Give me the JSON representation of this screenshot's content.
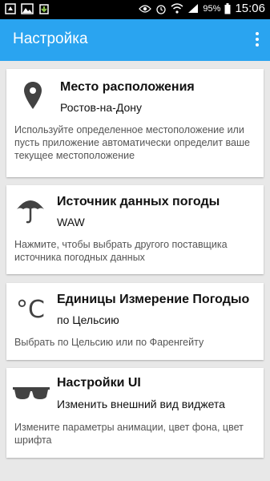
{
  "status_bar": {
    "battery_pct": "95%",
    "time": "15:06"
  },
  "app_bar": {
    "title": "Настройка",
    "overflow_icon": "more-vert-icon"
  },
  "cards": [
    {
      "icon": "location-pin-icon",
      "title": "Место расположения",
      "value": "Ростов-на-Дону",
      "description": "Используйте определенное местоположение или пусть приложение автоматически определит ваше текущее местоположение"
    },
    {
      "icon": "umbrella-icon",
      "title": "Источник данных погоды",
      "value": "WAW",
      "description": "Нажмите, чтобы выбрать другого поставщика источника погодных данных"
    },
    {
      "icon": "celsius-icon",
      "icon_glyph": "°C",
      "title": "Единицы Измерение Погодыо",
      "value": "по Цельсию",
      "description": "Выбрать по Цельсию или по Фаренгейту"
    },
    {
      "icon": "sunglasses-icon",
      "title": "Настройки UI",
      "value": "Изменить внешний вид виджета",
      "description": "Измените параметры анимации, цвет фона, цвет шрифта"
    }
  ]
}
